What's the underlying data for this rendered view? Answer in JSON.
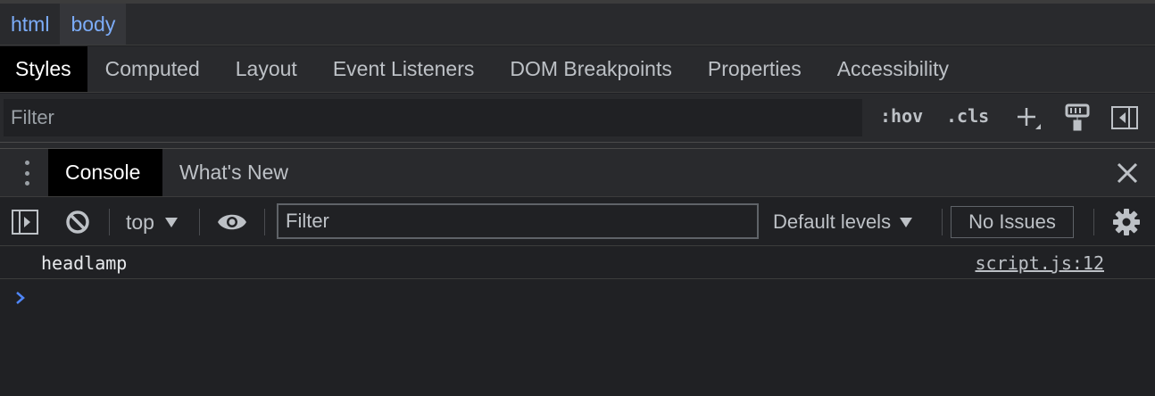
{
  "breadcrumb": {
    "items": [
      "html",
      "body"
    ]
  },
  "panel_tabs": [
    "Styles",
    "Computed",
    "Layout",
    "Event Listeners",
    "DOM Breakpoints",
    "Properties",
    "Accessibility"
  ],
  "styles_filter": {
    "placeholder": "Filter",
    "hov": ":hov",
    "cls": ".cls"
  },
  "drawer": {
    "tabs": [
      "Console",
      "What's New"
    ]
  },
  "console_toolbar": {
    "context": "top",
    "filter_placeholder": "Filter",
    "levels": "Default levels",
    "issues": "No Issues"
  },
  "console": {
    "messages": [
      {
        "text": "headlamp",
        "source": "script.js:12"
      }
    ]
  },
  "colors": {
    "background": "#202124",
    "toolbar": "#292a2d",
    "link": "#7cacf8",
    "prompt": "#4f86f7"
  }
}
